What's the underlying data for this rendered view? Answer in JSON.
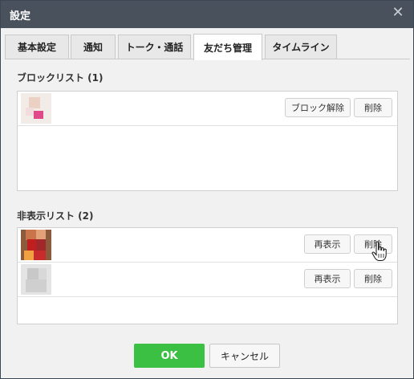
{
  "window": {
    "title": "設定",
    "close_icon": "close-icon"
  },
  "tabs": [
    {
      "label": "基本設定",
      "active": false
    },
    {
      "label": "通知",
      "active": false
    },
    {
      "label": "トーク・通話",
      "active": false
    },
    {
      "label": "友だち管理",
      "active": true
    },
    {
      "label": "タイムライン",
      "active": false
    }
  ],
  "block_list": {
    "title": "ブロックリスト (1)",
    "items": [
      {
        "name": "",
        "unblock_label": "ブロック解除",
        "delete_label": "削除"
      }
    ]
  },
  "hidden_list": {
    "title": "非表示リスト (2)",
    "items": [
      {
        "name": "",
        "unhide_label": "再表示",
        "delete_label": "削除"
      },
      {
        "name": "",
        "unhide_label": "再表示",
        "delete_label": "削除"
      }
    ]
  },
  "footer": {
    "ok_label": "OK",
    "cancel_label": "キャンセル"
  },
  "colors": {
    "titlebar": "#48515c",
    "ok_green": "#3bc044"
  },
  "icons": {
    "cursor": "hand-pointer-icon"
  }
}
